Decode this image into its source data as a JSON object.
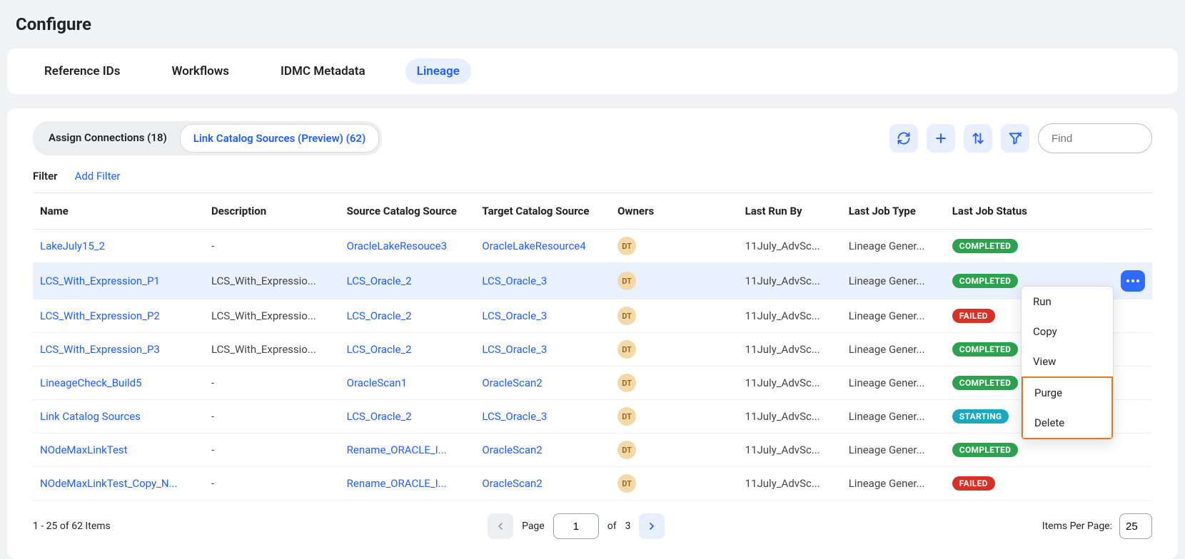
{
  "page_title": "Configure",
  "tabs": [
    "Reference IDs",
    "Workflows",
    "IDMC Metadata",
    "Lineage"
  ],
  "active_tab": 3,
  "subtabs": [
    {
      "label": "Assign Connections (18)"
    },
    {
      "label": "Link Catalog Sources (Preview) (62)"
    }
  ],
  "active_subtab": 1,
  "find_placeholder": "Find",
  "filter_label": "Filter",
  "add_filter_label": "Add Filter",
  "columns": [
    "Name",
    "Description",
    "Source Catalog Source",
    "Target Catalog Source",
    "Owners",
    "Last Run By",
    "Last Job Type",
    "Last Job Status"
  ],
  "rows": [
    {
      "name": "LakeJuly15_2",
      "description": "-",
      "source": "OracleLakeResouce3",
      "target": "OracleLakeResource4",
      "owner": "DT",
      "last_run_by": "11July_AdvSc...",
      "last_job_type": "Lineage Gener...",
      "status": "COMPLETED"
    },
    {
      "name": "LCS_With_Expression_P1",
      "description": "LCS_With_Expressio...",
      "source": "LCS_Oracle_2",
      "target": "LCS_Oracle_3",
      "owner": "DT",
      "last_run_by": "11July_AdvSc...",
      "last_job_type": "Lineage Gener...",
      "status": "COMPLETED",
      "highlight": true
    },
    {
      "name": "LCS_With_Expression_P2",
      "description": "LCS_With_Expressio...",
      "source": "LCS_Oracle_2",
      "target": "LCS_Oracle_3",
      "owner": "DT",
      "last_run_by": "11July_AdvSc...",
      "last_job_type": "Lineage Gener...",
      "status": "FAILED"
    },
    {
      "name": "LCS_With_Expression_P3",
      "description": "LCS_With_Expressio...",
      "source": "LCS_Oracle_2",
      "target": "LCS_Oracle_3",
      "owner": "DT",
      "last_run_by": "11July_AdvSc...",
      "last_job_type": "Lineage Gener...",
      "status": "COMPLETED"
    },
    {
      "name": "LineageCheck_Build5",
      "description": "-",
      "source": "OracleScan1",
      "target": "OracleScan2",
      "owner": "DT",
      "last_run_by": "11July_AdvSc...",
      "last_job_type": "Lineage Gener...",
      "status": "COMPLETED"
    },
    {
      "name": "Link Catalog Sources",
      "description": "-",
      "source": "LCS_Oracle_2",
      "target": "LCS_Oracle_3",
      "owner": "DT",
      "last_run_by": "11July_AdvSc...",
      "last_job_type": "Lineage Gener...",
      "status": "STARTING"
    },
    {
      "name": "NOdeMaxLinkTest",
      "description": "-",
      "source": "Rename_ORACLE_I...",
      "target": "OracleScan2",
      "owner": "DT",
      "last_run_by": "11July_AdvSc...",
      "last_job_type": "Lineage Gener...",
      "status": "COMPLETED"
    },
    {
      "name": "NOdeMaxLinkTest_Copy_N...",
      "description": "-",
      "source": "Rename_ORACLE_I...",
      "target": "OracleScan2",
      "owner": "DT",
      "last_run_by": "11July_AdvSc...",
      "last_job_type": "Lineage Gener...",
      "status": "FAILED"
    }
  ],
  "pager": {
    "summary": "1 - 25 of 62 Items",
    "page_label": "Page",
    "page_value": "1",
    "of_label": "of",
    "total_pages": "3",
    "items_per_page_label": "Items Per Page:",
    "items_per_page_value": "25"
  },
  "context_menu": [
    "Run",
    "Copy",
    "View",
    "Purge",
    "Delete"
  ]
}
